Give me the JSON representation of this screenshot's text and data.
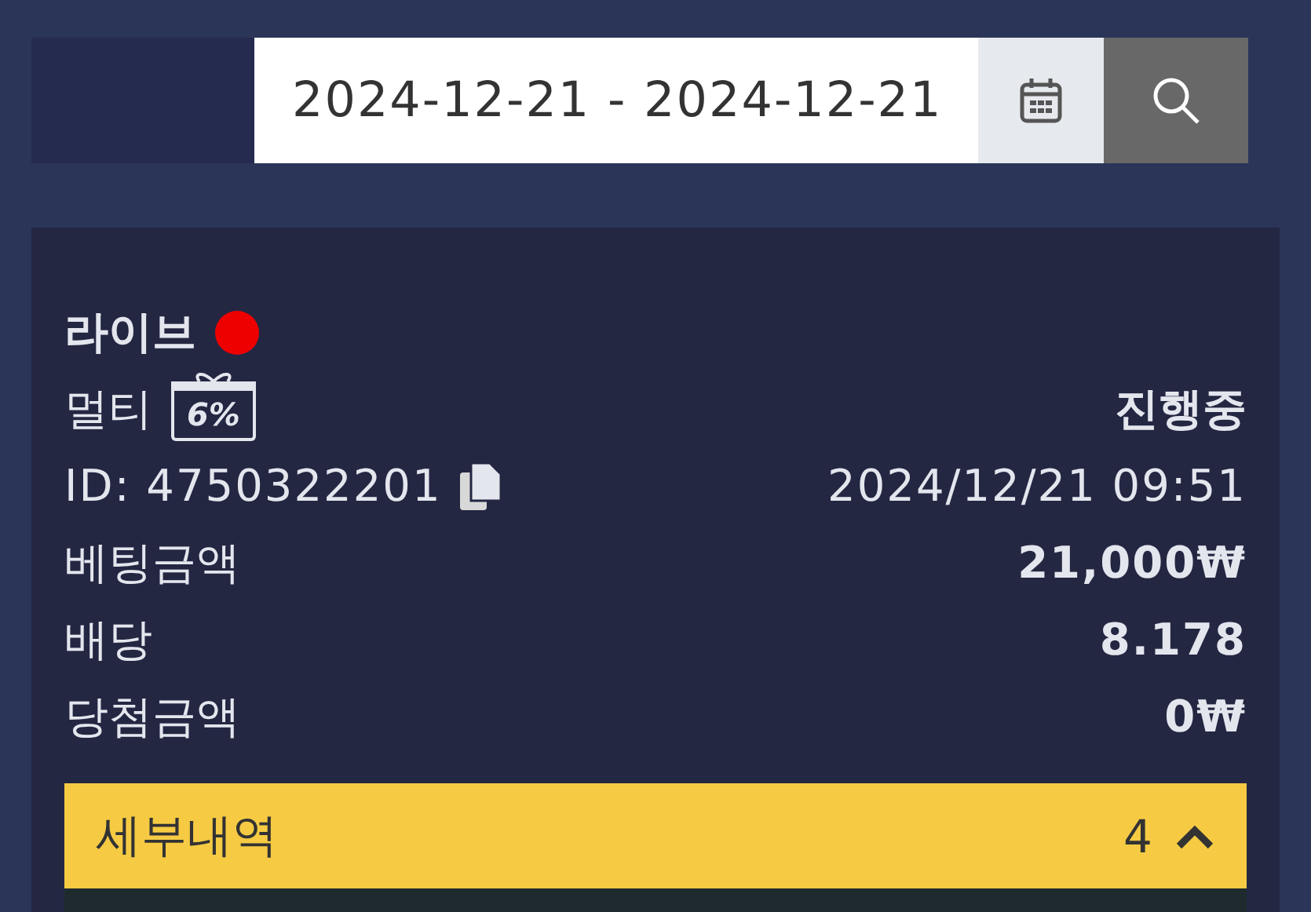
{
  "search_bar": {
    "date_range": "2024-12-21 - 2024-12-21"
  },
  "bet": {
    "type": "라이브",
    "live": true,
    "mode": "멀티",
    "bonus_badge": "6%",
    "status": "진행중",
    "id": "ID: 4750322201",
    "datetime": "2024/12/21 09:51",
    "rows": [
      {
        "label": "베팅금액",
        "value": "21,000₩"
      },
      {
        "label": "배당",
        "value": "8.178"
      },
      {
        "label": "당첨금액",
        "value": "0₩"
      }
    ]
  },
  "details": {
    "label": "세부내역",
    "count": "4",
    "expanded": true
  }
}
